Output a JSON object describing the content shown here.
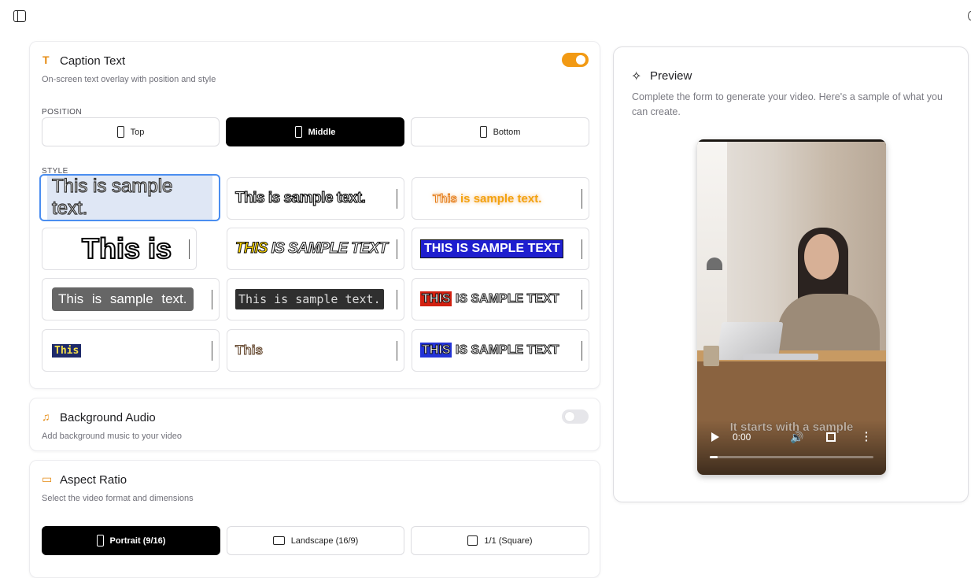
{
  "caption": {
    "title": "Caption Text",
    "subtitle": "On-screen text overlay with position and style",
    "enabled": true,
    "position_label": "POSITION",
    "positions": [
      "Top",
      "Middle",
      "Bottom"
    ],
    "selected_position": "Middle",
    "style_label": "STYLE",
    "styles": [
      "This is sample text.",
      "This is sample text.",
      "This is sample text.",
      "This is",
      "THIS IS SAMPLE TEXT",
      "THIS IS SAMPLE TEXT",
      "This is sample text.",
      "This is sample text.",
      "THIS IS SAMPLE TEXT",
      "This",
      "This",
      "THIS IS SAMPLE TEXT"
    ],
    "selected_style_index": 0
  },
  "background_audio": {
    "title": "Background Audio",
    "subtitle": "Add background music to your video",
    "enabled": false
  },
  "aspect_ratio": {
    "title": "Aspect Ratio",
    "subtitle": "Select the video format and dimensions",
    "options": [
      "Portrait (9/16)",
      "Landscape (16/9)",
      "1/1 (Square)"
    ],
    "selected": "Portrait (9/16)"
  },
  "preview": {
    "title": "Preview",
    "description": "Complete the form to generate your video. Here's a sample of what you can create.",
    "video": {
      "subtitle": "It starts with a sample",
      "time": "0:00",
      "progress": 0.05
    }
  },
  "colors": {
    "accent": "#f29a14",
    "selected_border": "#4b8ef0",
    "active_segment": "#000000"
  },
  "icons": {
    "sidebar_toggle": "sidebar-icon",
    "caption": "text-icon",
    "audio": "music-icon",
    "aspect": "monitor-icon",
    "preview": "sparkle-icon"
  }
}
